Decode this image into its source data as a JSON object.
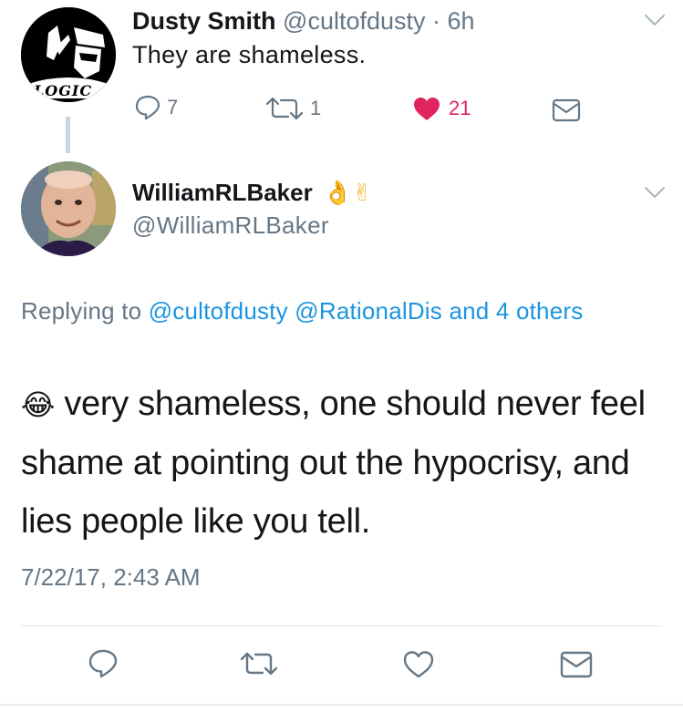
{
  "parent_tweet": {
    "author_name": "Dusty Smith",
    "author_handle": "@cultofdusty",
    "time": "· 6h",
    "text": "They are shameless.",
    "avatar_label": "LOGIC",
    "reply_count": "7",
    "retweet_count": "1",
    "like_count": "21",
    "liked": true
  },
  "reply_tweet": {
    "author_name": "WilliamRLBaker",
    "name_emojis": "👌✌",
    "author_handle": "@WilliamRLBaker",
    "replying_prefix": "Replying to",
    "replying_mentions": [
      "@cultofdusty",
      "@RationalDis"
    ],
    "replying_and": "and 4",
    "replying_others": "others",
    "emoji": "😂",
    "text": " very shameless, one should never feel shame at pointing out the hypocrisy, and lies people like you tell.",
    "timestamp": "7/22/17, 2:43 AM"
  },
  "colors": {
    "link": "#1b95e0",
    "secondary_text": "#657786",
    "like_red": "#e0245e",
    "icon_gray": "#657786"
  }
}
